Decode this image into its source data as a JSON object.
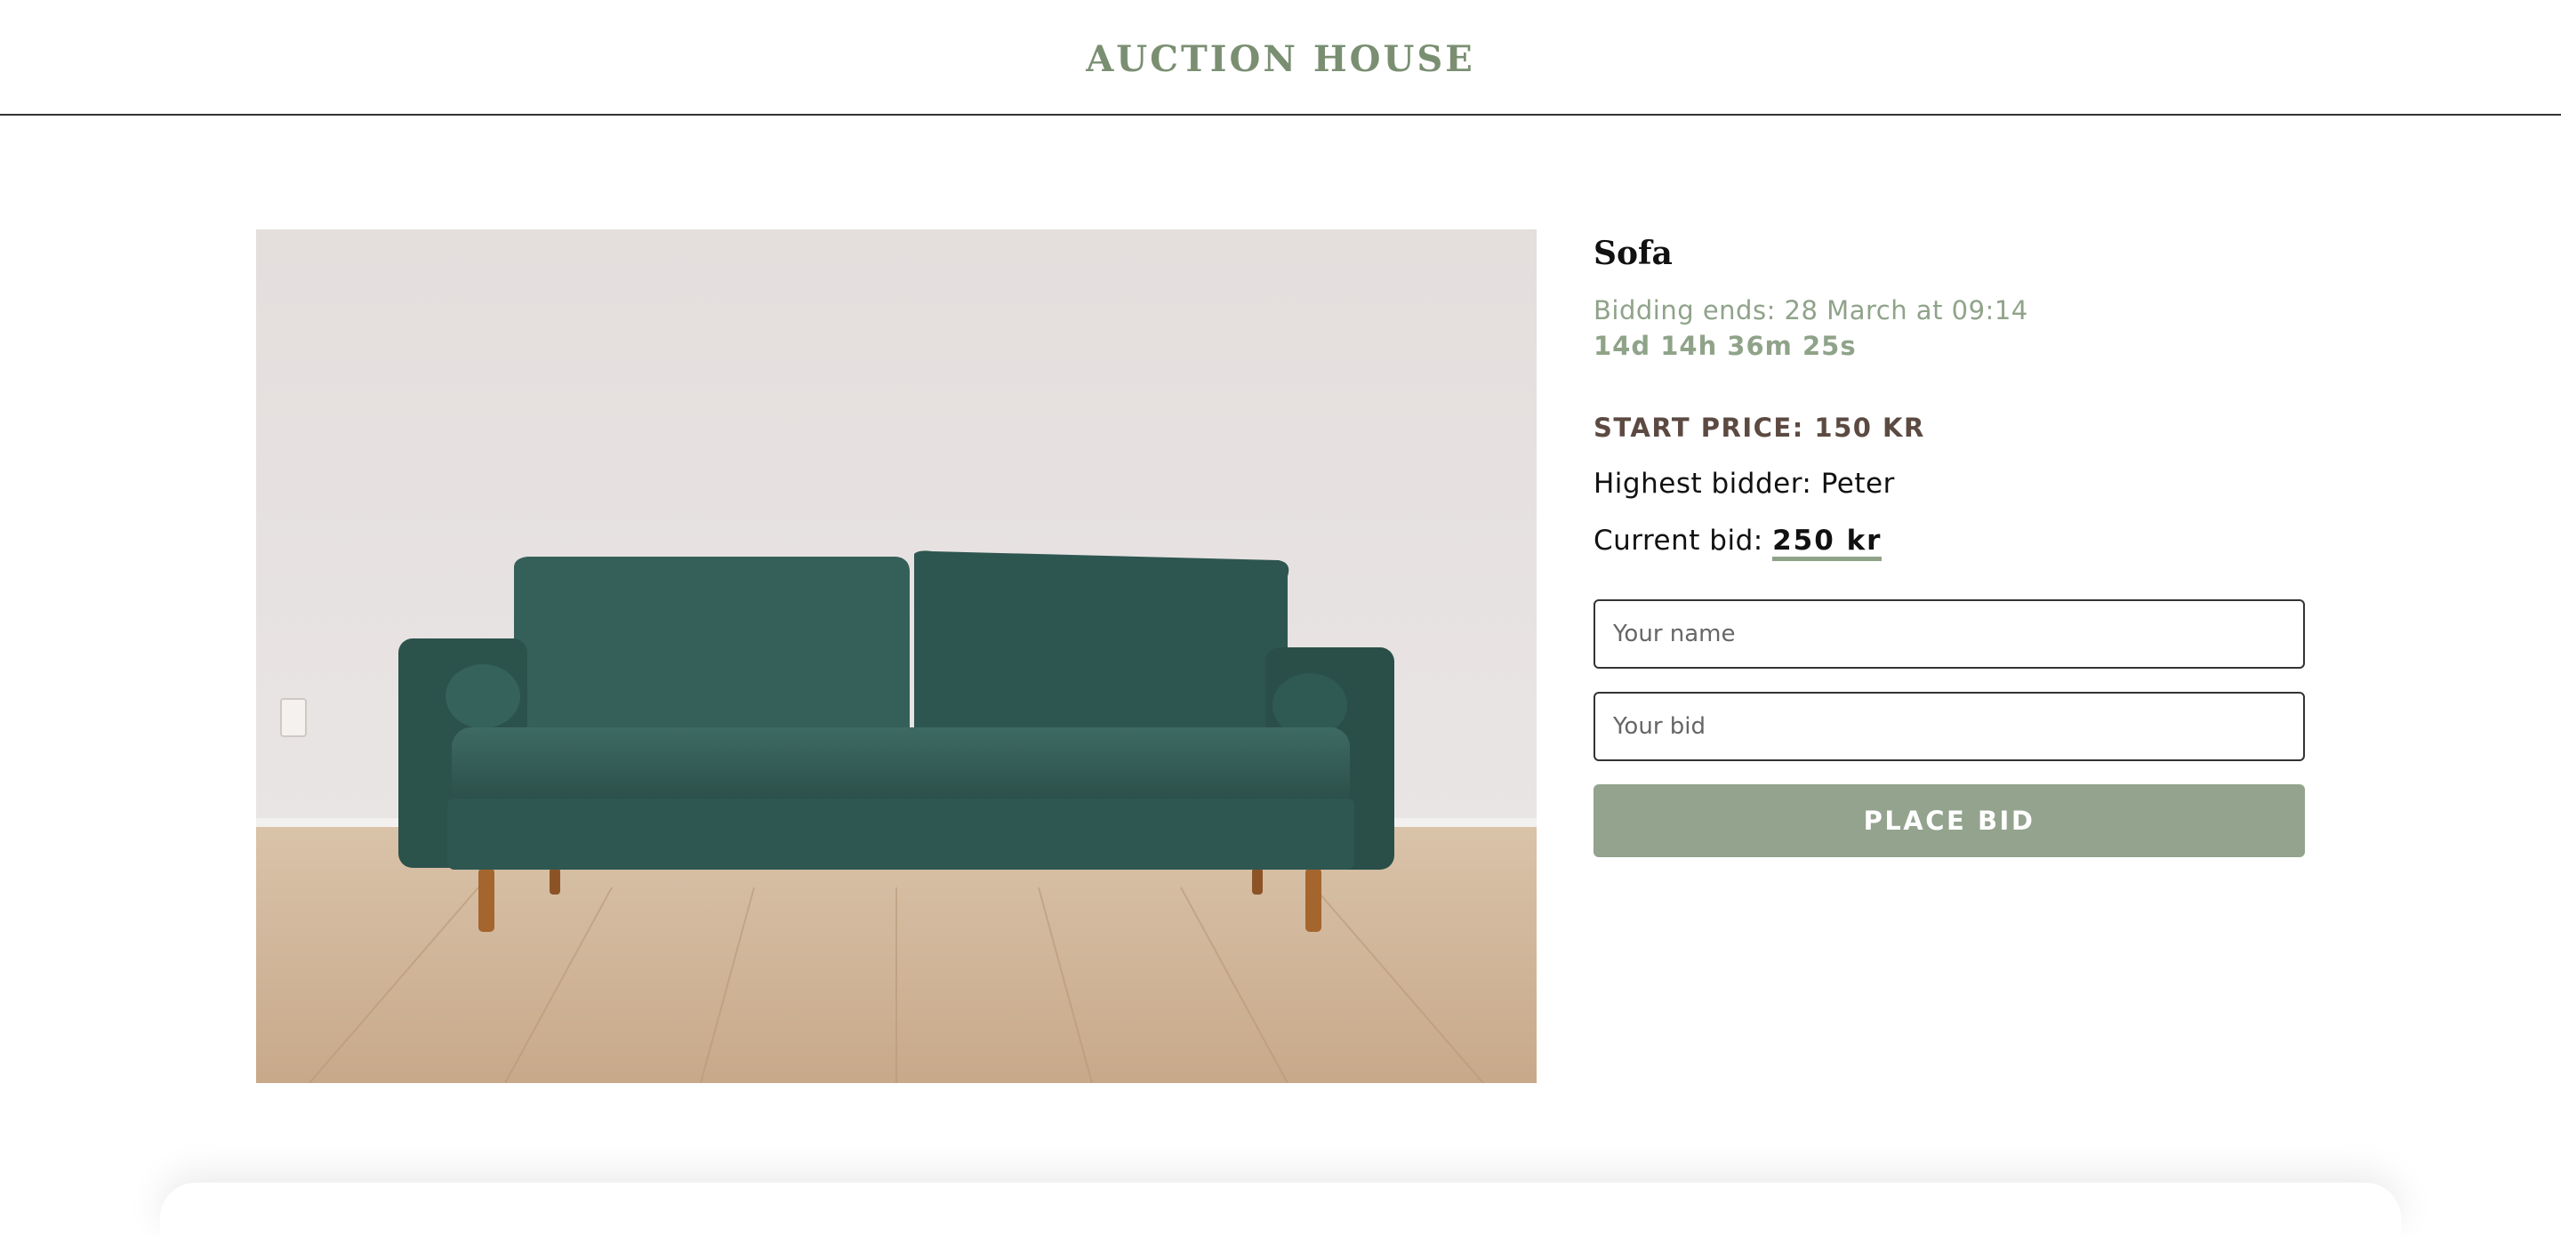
{
  "header": {
    "brand": "AUCTION HOUSE"
  },
  "product": {
    "image_icon": "sofa-photo",
    "title": "Sofa",
    "bidding_ends_label": "Bidding ends: 28 March at 09:14",
    "countdown": "14d 14h 36m 25s",
    "start_price": "START PRICE: 150 KR",
    "highest_bidder": "Highest bidder: Peter",
    "current_bid_label": "Current bid: ",
    "current_bid_value": "250 kr"
  },
  "form": {
    "name_placeholder": "Your name",
    "bid_placeholder": "Your bid",
    "submit_label": "PLACE BID"
  },
  "colors": {
    "accent": "#8fa389",
    "button": "#93a38d",
    "brand": "#7a8f72",
    "start_price": "#5c4a42"
  }
}
